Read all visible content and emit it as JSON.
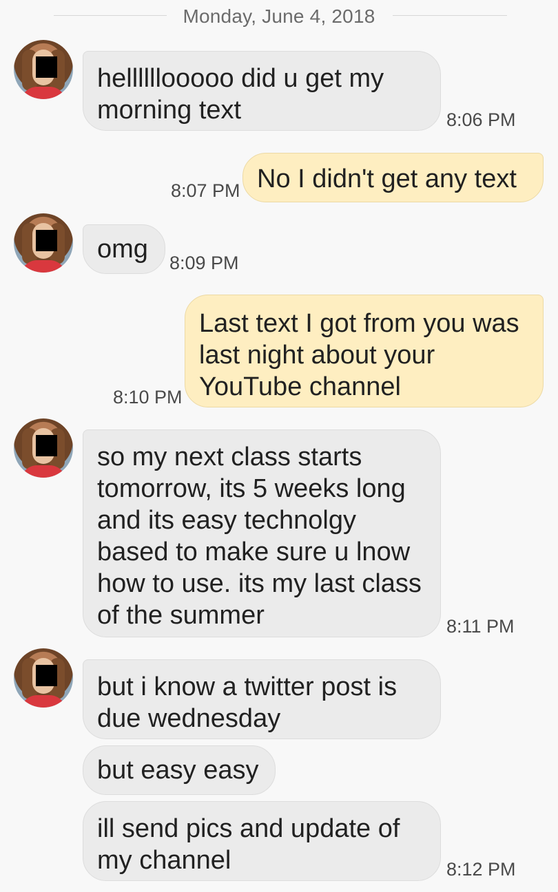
{
  "date_header": "Monday, June 4, 2018",
  "messages": [
    {
      "direction": "incoming",
      "text": "hellllllooooo did u get my morning text",
      "time": "8:06 PM"
    },
    {
      "direction": "outgoing",
      "text": "No I didn't get any text",
      "time": "8:07 PM"
    },
    {
      "direction": "incoming",
      "text": "omg",
      "time": "8:09 PM"
    },
    {
      "direction": "outgoing",
      "text": "Last text I got from you was last night about your YouTube channel",
      "time": "8:10 PM"
    },
    {
      "direction": "incoming",
      "text": "so my next class starts tomorrow, its 5 weeks long and its easy technolgy based to make sure u lnow how to use. its my last class of the summer",
      "time": "8:11 PM"
    },
    {
      "direction": "incoming",
      "text": "but i know a twitter post is due wednesday",
      "time": ""
    },
    {
      "direction": "incoming",
      "text": "but easy easy",
      "time": ""
    },
    {
      "direction": "incoming",
      "text": "ill send pics and update of my channel",
      "time": "8:12 PM"
    }
  ],
  "colors": {
    "background": "#f8f8f8",
    "incoming_bubble": "#ebebeb",
    "outgoing_bubble": "#feeec1"
  }
}
